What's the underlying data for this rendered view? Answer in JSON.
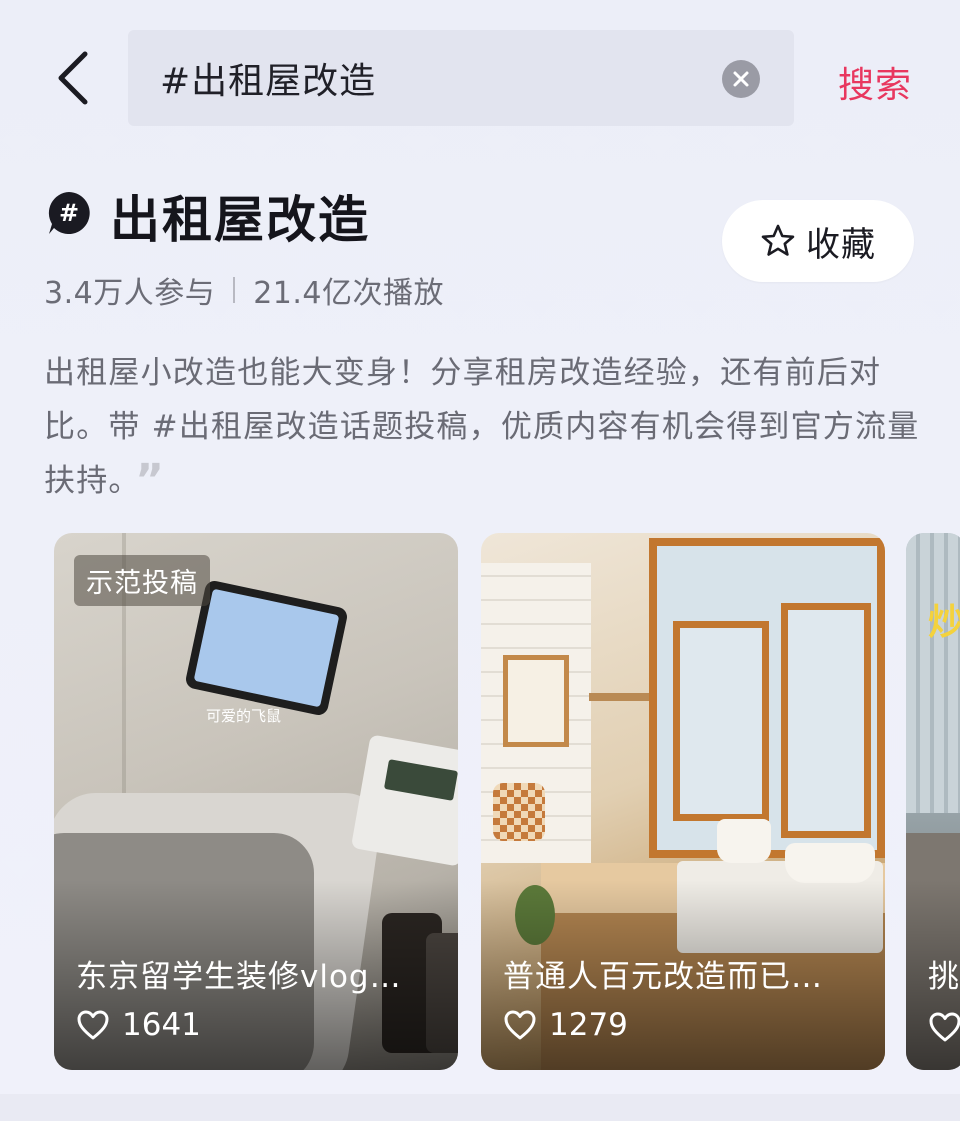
{
  "search": {
    "query": "#出租屋改造",
    "submit_label": "搜索"
  },
  "topic": {
    "title": "出租屋改造",
    "participants": "3.4万人参与",
    "plays": "21.4亿次播放",
    "favorite_label": "收藏",
    "description": "出租屋小改造也能大变身！分享租房改造经验，还有前后对比。带 #出租屋改造话题投稿，优质内容有机会得到官方流量扶持。"
  },
  "cards": [
    {
      "badge": "示范投稿",
      "screen_caption": "可爱的飞鼠",
      "title": "东京留学生装修vlog…",
      "likes": "1641"
    },
    {
      "title": "普通人百元改造而已…",
      "likes": "1279"
    },
    {
      "title": "挑",
      "overlay": "炒"
    }
  ],
  "colors": {
    "accent": "#e8375f",
    "background": "#eceef8",
    "search_bg": "#e2e4ef"
  },
  "icons": {
    "back": "back-arrow-icon",
    "clear": "clear-icon",
    "topic": "hashtag-bubble-icon",
    "favorite": "star-icon",
    "like": "heart-icon",
    "quote": "quote-icon"
  }
}
